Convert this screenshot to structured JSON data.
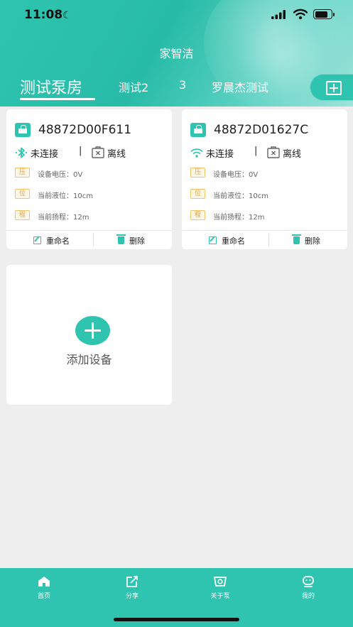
{
  "status_bar": {
    "time": "11:08"
  },
  "app": {
    "title": "家智洁"
  },
  "tabs": [
    {
      "label": "测试泵房",
      "active": true
    },
    {
      "label": "测试2",
      "active": false
    },
    {
      "label": "3",
      "active": false
    },
    {
      "label": "罗晨杰测试",
      "active": false
    }
  ],
  "devices": [
    {
      "name": "48872D00F611",
      "connection_icon": "bluetooth-icon",
      "connection_status": "未连接",
      "separator": "|",
      "online_status": "离线",
      "stats": [
        {
          "badge": "压",
          "label": "设备电压：0V"
        },
        {
          "badge": "位",
          "label": "当前液位：10cm"
        },
        {
          "badge": "程",
          "label": "当前扬程：12m"
        }
      ],
      "rename_label": "重命名",
      "delete_label": "删除"
    },
    {
      "name": "48872D01627C",
      "connection_icon": "wifi-icon",
      "connection_status": "未连接",
      "separator": "|",
      "online_status": "离线",
      "stats": [
        {
          "badge": "压",
          "label": "设备电压：0V"
        },
        {
          "badge": "位",
          "label": "当前液位：10cm"
        },
        {
          "badge": "程",
          "label": "当前扬程：12m"
        }
      ],
      "rename_label": "重命名",
      "delete_label": "删除"
    }
  ],
  "add_device": {
    "label": "添加设备"
  },
  "bottom_nav": [
    {
      "label": "首页",
      "icon": "home-icon",
      "active": true
    },
    {
      "label": "分享",
      "icon": "share-icon",
      "active": false
    },
    {
      "label": "关于泵",
      "icon": "pump-icon",
      "active": false
    },
    {
      "label": "我的",
      "icon": "profile-icon",
      "active": false
    }
  ],
  "colors": {
    "accent": "#2ec4b0",
    "badge_border": "#f3c26a",
    "badge_text": "#e5a23a",
    "background": "#eeeeee"
  }
}
